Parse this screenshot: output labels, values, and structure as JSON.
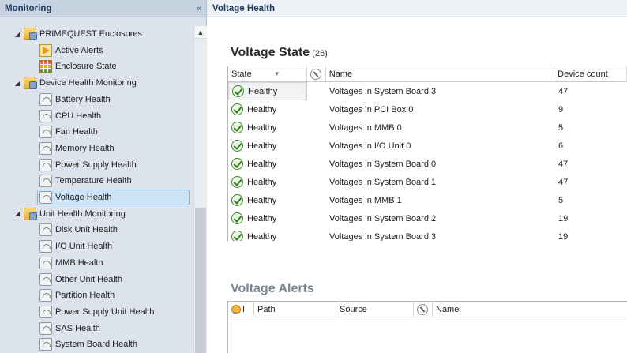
{
  "nav": {
    "title": "Monitoring",
    "collapse_glyph": "«",
    "tree": [
      {
        "label": "PRIMEQUEST Enclosures",
        "icon": "folder-icon",
        "expanded": true
      },
      {
        "label": "Active Alerts",
        "icon": "alert-view-icon"
      },
      {
        "label": "Enclosure State",
        "icon": "state-view-icon"
      },
      {
        "label": "Device Health Monitoring",
        "icon": "folder-icon",
        "expanded": true
      },
      {
        "label": "Battery Health",
        "icon": "dashboard-icon"
      },
      {
        "label": "CPU Health",
        "icon": "dashboard-icon"
      },
      {
        "label": "Fan Health",
        "icon": "dashboard-icon"
      },
      {
        "label": "Memory Health",
        "icon": "dashboard-icon"
      },
      {
        "label": "Power Supply Health",
        "icon": "dashboard-icon"
      },
      {
        "label": "Temperature Health",
        "icon": "dashboard-icon"
      },
      {
        "label": "Voltage Health",
        "icon": "dashboard-icon",
        "selected": true
      },
      {
        "label": "Unit Health Monitoring",
        "icon": "folder-icon",
        "expanded": true
      },
      {
        "label": "Disk Unit Health",
        "icon": "dashboard-icon"
      },
      {
        "label": "I/O Unit Health",
        "icon": "dashboard-icon"
      },
      {
        "label": "MMB Health",
        "icon": "dashboard-icon"
      },
      {
        "label": "Other Unit Health",
        "icon": "dashboard-icon"
      },
      {
        "label": "Partition Health",
        "icon": "dashboard-icon"
      },
      {
        "label": "Power Supply Unit Health",
        "icon": "dashboard-icon"
      },
      {
        "label": "SAS Health",
        "icon": "dashboard-icon"
      },
      {
        "label": "System Board Health",
        "icon": "dashboard-icon"
      }
    ]
  },
  "main": {
    "title": "Voltage Health",
    "state_section": {
      "title": "Voltage State",
      "count": "(26)",
      "columns": {
        "state": "State",
        "name": "Name",
        "device_count": "Device count"
      },
      "rows": [
        {
          "state": "Healthy",
          "name": "Voltages in System Board 3",
          "count": "47"
        },
        {
          "state": "Healthy",
          "name": "Voltages in PCI Box 0",
          "count": "9"
        },
        {
          "state": "Healthy",
          "name": "Voltages in MMB 0",
          "count": "5"
        },
        {
          "state": "Healthy",
          "name": "Voltages in I/O Unit 0",
          "count": "6"
        },
        {
          "state": "Healthy",
          "name": "Voltages in System Board 0",
          "count": "47"
        },
        {
          "state": "Healthy",
          "name": "Voltages in System Board 1",
          "count": "47"
        },
        {
          "state": "Healthy",
          "name": "Voltages in MMB 1",
          "count": "5"
        },
        {
          "state": "Healthy",
          "name": "Voltages in System Board 2",
          "count": "19"
        },
        {
          "state": "Healthy",
          "name": "Voltages in System Board 3",
          "count": "19"
        }
      ]
    },
    "alerts_section": {
      "title": "Voltage Alerts",
      "columns": {
        "icon_col": "I",
        "path": "Path",
        "source": "Source",
        "name": "Name"
      }
    }
  }
}
